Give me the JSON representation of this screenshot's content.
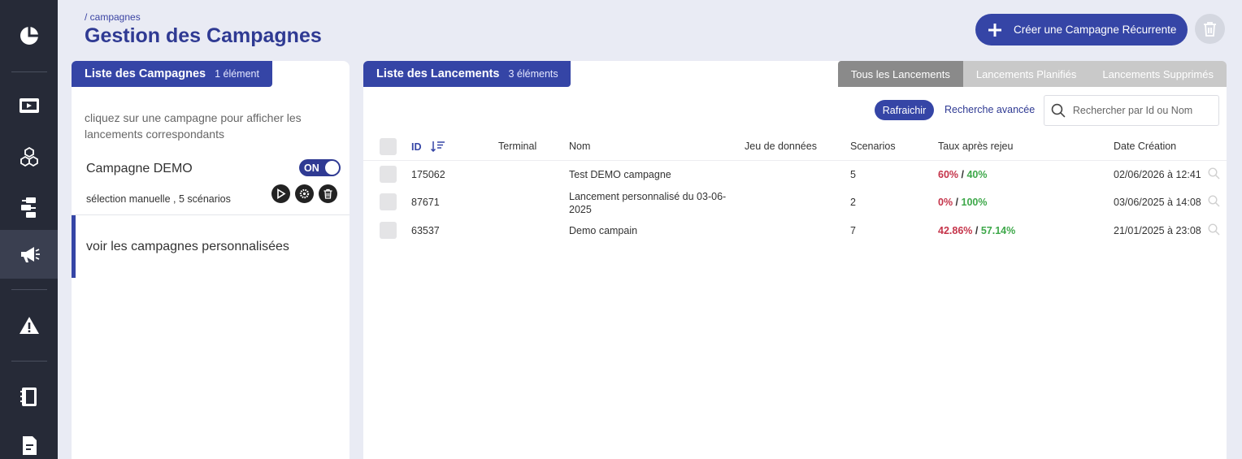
{
  "breadcrumb": "/ campagnes",
  "page_title": "Gestion des Campagnes",
  "create_button": "Créer une Campagne Récurrente",
  "left_panel": {
    "title": "Liste des Campagnes",
    "count": "1 élément",
    "hint": "cliquez sur une campagne pour afficher les lancements correspondants",
    "campaign": {
      "name": "Campagne DEMO",
      "toggle": "ON",
      "subtitle": "sélection manuelle , 5 scénarios"
    },
    "custom_link": "voir les campagnes personnalisées"
  },
  "right_panel": {
    "title": "Liste des Lancements",
    "count": "3 éléments",
    "tabs": [
      "Tous les Lancements",
      "Lancements Planifiés",
      "Lancements Supprimés"
    ],
    "refresh_button": "Rafraichir",
    "advanced_search": "Recherche avancée",
    "search_placeholder": "Rechercher par Id ou Nom",
    "columns": [
      "ID",
      "Terminal",
      "Nom",
      "Jeu de données",
      "Scenarios",
      "Taux après rejeu",
      "Date Création"
    ],
    "rows": [
      {
        "id": "175062",
        "terminal": "",
        "name": "Test DEMO campagne",
        "dataset": "",
        "scenarios": "5",
        "rate_fail": "60%",
        "rate_sep": " / ",
        "rate_pass": "40%",
        "date": "02/06/2026 à 12:41"
      },
      {
        "id": "87671",
        "terminal": "",
        "name": "Lancement personnalisé du 03-06-2025",
        "dataset": "",
        "scenarios": "2",
        "rate_fail": "0%",
        "rate_sep": " / ",
        "rate_pass": "100%",
        "date": "03/06/2025 à 14:08"
      },
      {
        "id": "63537",
        "terminal": "",
        "name": "Demo campain",
        "dataset": "",
        "scenarios": "7",
        "rate_fail": "42.86%",
        "rate_sep": " / ",
        "rate_pass": "57.14%",
        "date": "21/01/2025 à 23:08"
      }
    ]
  },
  "colors": {
    "sidebar": "#262a37",
    "accent": "#3545a6",
    "fail": "#c5344a",
    "pass": "#3ea84a"
  },
  "sidebar_icons": [
    "dashboard-icon",
    "video-icon",
    "cubes-icon",
    "workflow-icon",
    "megaphone-icon",
    "warning-icon",
    "notebook-icon",
    "document-icon"
  ]
}
